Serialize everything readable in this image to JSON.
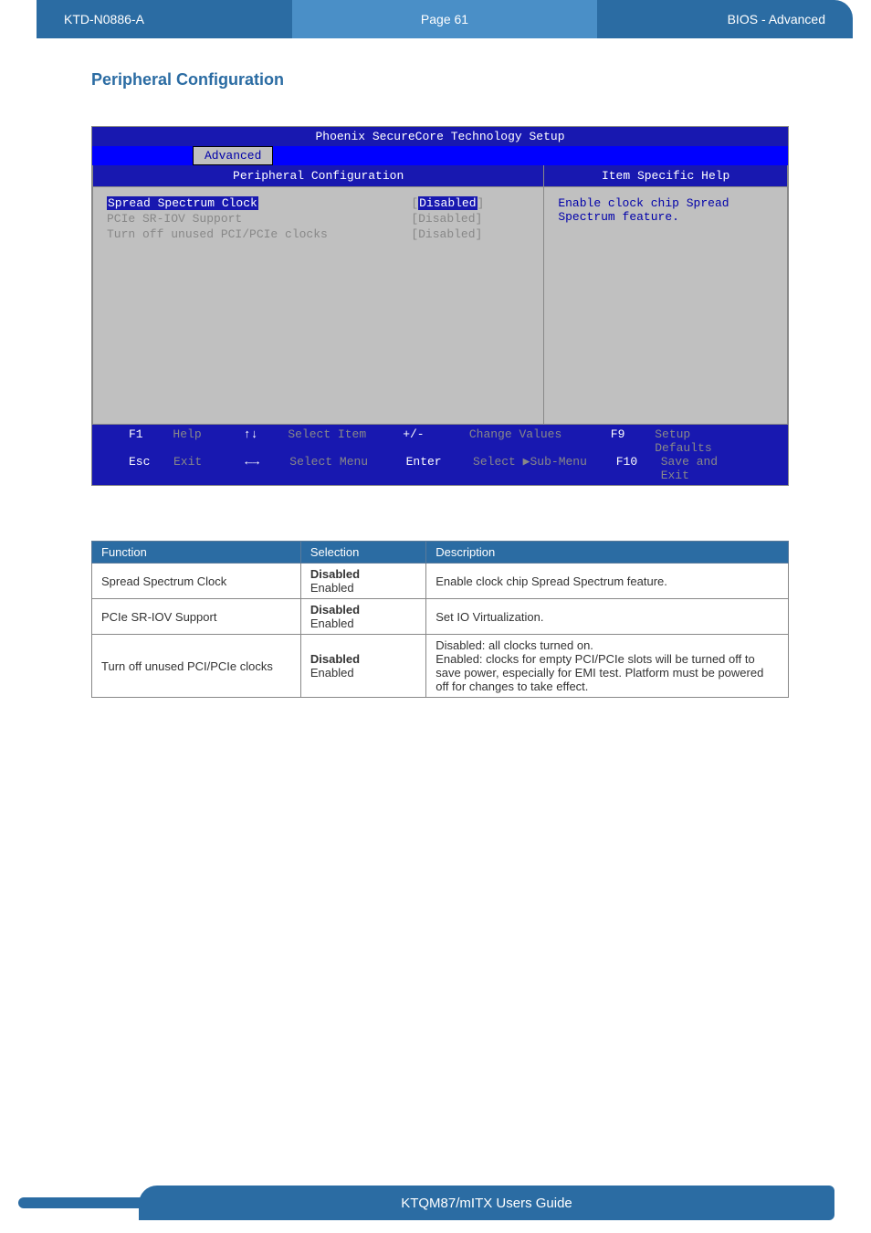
{
  "header": {
    "left": "KTD-N0886-A",
    "mid": "Page 61",
    "right": "BIOS  - Advanced"
  },
  "section_title": "Peripheral Configuration",
  "bios": {
    "title": "Phoenix SecureCore Technology Setup",
    "tab": "Advanced",
    "subheader_left": "Peripheral Configuration",
    "subheader_right": "Item Specific Help",
    "rows": [
      {
        "label": "Spread Spectrum Clock",
        "value_pre": "[",
        "value_sel": "Disabled",
        "value_post": "]",
        "selected": true
      },
      {
        "label": "PCIe SR-IOV Support",
        "value": "[Disabled]"
      },
      {
        "label": "Turn off unused PCI/PCIe clocks",
        "value": "[Disabled]"
      }
    ],
    "help": "Enable clock chip Spread Spectrum feature.",
    "footer": {
      "r1": {
        "k1": "F1",
        "a1": "Help",
        "s1": "↑↓",
        "l1": "Select Item",
        "s2": "+/-",
        "l2": "Change Values",
        "k2": "F9",
        "a2": "Setup Defaults"
      },
      "r2": {
        "k1": "Esc",
        "a1": "Exit",
        "s1": "←→",
        "l1": "Select Menu",
        "s2": "Enter",
        "l2": "Select ▶Sub-Menu",
        "k2": "F10",
        "a2": "Save and Exit"
      }
    }
  },
  "table": {
    "headers": {
      "c1": "Function",
      "c2": "Selection",
      "c3": "Description"
    },
    "rows": [
      {
        "func": "Spread Spectrum Clock",
        "sel_bold": "Disabled",
        "sel_rest": "Enabled",
        "desc": "Enable clock chip Spread Spectrum feature."
      },
      {
        "func": "PCIe SR-IOV Support",
        "sel_bold": "Disabled",
        "sel_rest": "Enabled",
        "desc": "Set IO Virtualization."
      },
      {
        "func": "Turn off unused PCI/PCIe clocks",
        "sel_bold": "Disabled",
        "sel_rest": "Enabled",
        "desc": "Disabled: all clocks turned on.\nEnabled: clocks for empty PCI/PCIe slots will be turned off to save power, especially for EMI test. Platform must be powered off for changes to take effect."
      }
    ]
  },
  "footer": "KTQM87/mITX Users Guide"
}
